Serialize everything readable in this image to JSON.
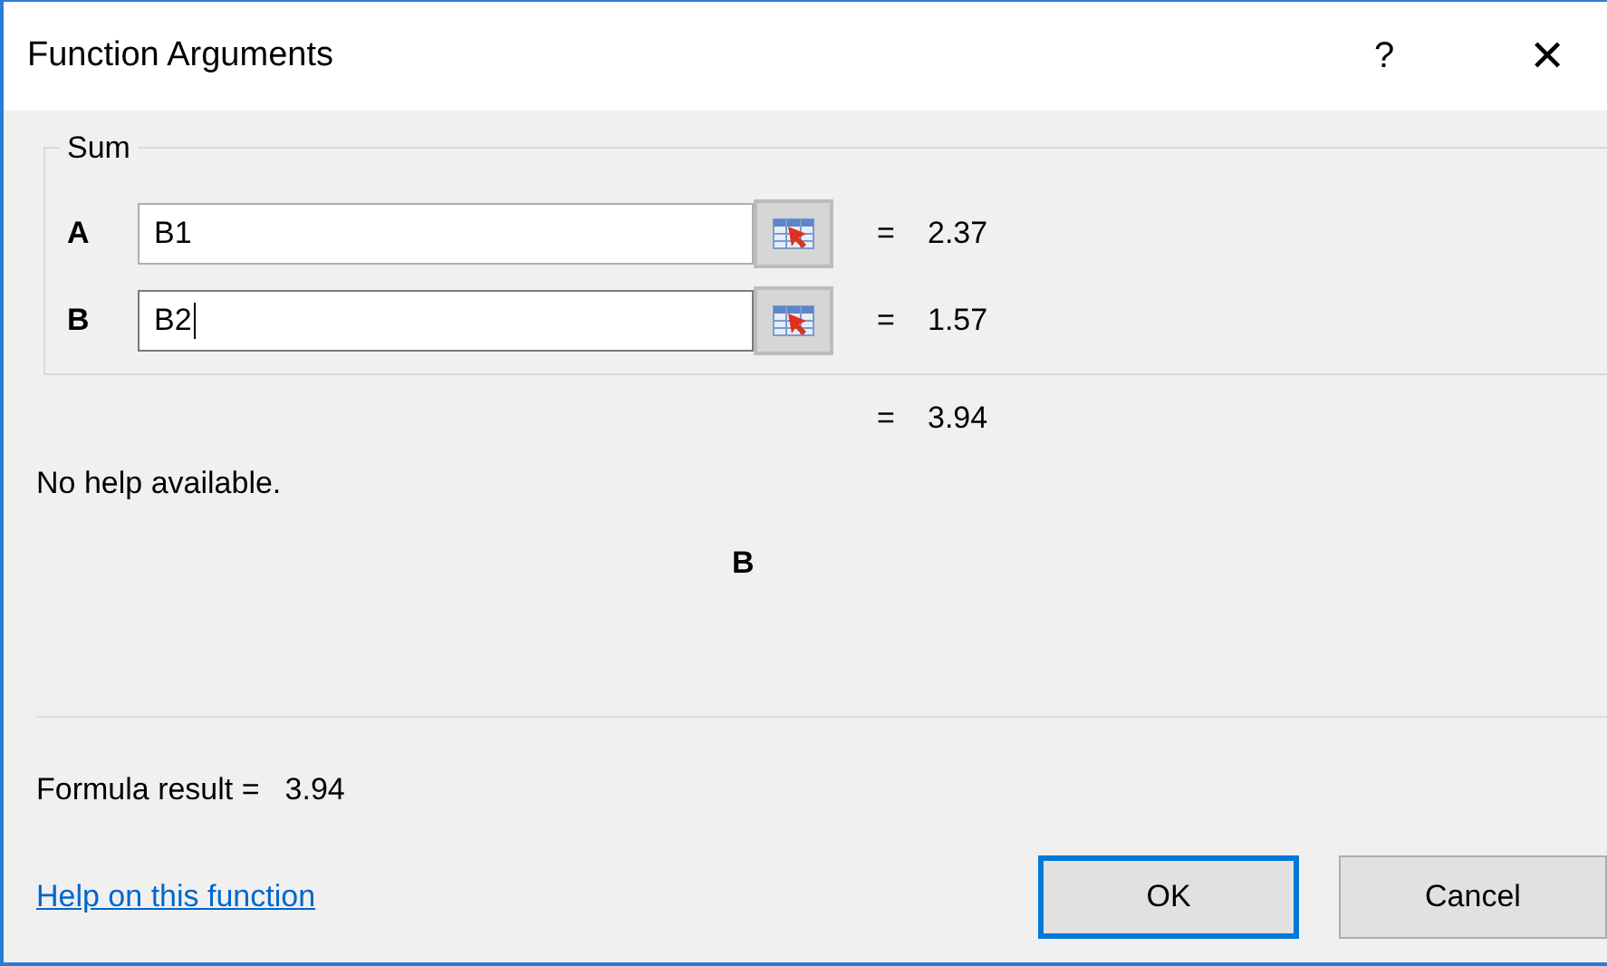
{
  "window": {
    "title": "Function Arguments",
    "help_glyph": "?",
    "close_glyph": "✕"
  },
  "group": {
    "legend": "Sum",
    "arguments": [
      {
        "name": "A",
        "value": "B1",
        "equals": "=",
        "result": "2.37",
        "focused": false
      },
      {
        "name": "B",
        "value": "B2",
        "equals": "=",
        "result": "1.57",
        "focused": true
      }
    ],
    "total_equals": "=",
    "total": "3.94"
  },
  "description": "No help available.",
  "argument_help": "B",
  "formula_result": {
    "label": "Formula result =",
    "value": "3.94"
  },
  "help_link": "Help on this function",
  "buttons": [
    {
      "label": "OK",
      "focused": true
    },
    {
      "label": "Cancel",
      "focused": false
    }
  ]
}
